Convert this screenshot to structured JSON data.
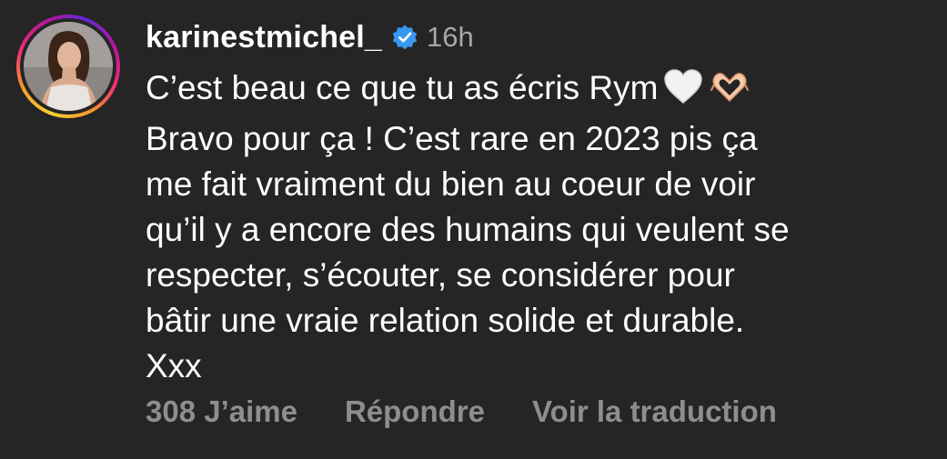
{
  "comment": {
    "username": "karinestmichel_",
    "time": "16h",
    "lines": [
      "C’est beau ce que tu as écris Rym",
      "Bravo pour ça ! C’est rare en 2023 pis ça",
      "me fait vraiment du bien au coeur de voir",
      "qu’il y a encore des humains qui veulent se",
      "respecter, s’écouter, se considérer pour",
      "bâtir une vraie relation solide et durable.",
      "Xxx"
    ],
    "emojis": [
      "white-heart-icon",
      "heart-hands-icon"
    ]
  },
  "actions": {
    "likes": "308 J’aime",
    "reply": "Répondre",
    "translate": "Voir la traduction"
  },
  "colors": {
    "background": "#252525",
    "text": "#ffffff",
    "muted": "#8e8e8e",
    "verified": "#3897f0"
  }
}
